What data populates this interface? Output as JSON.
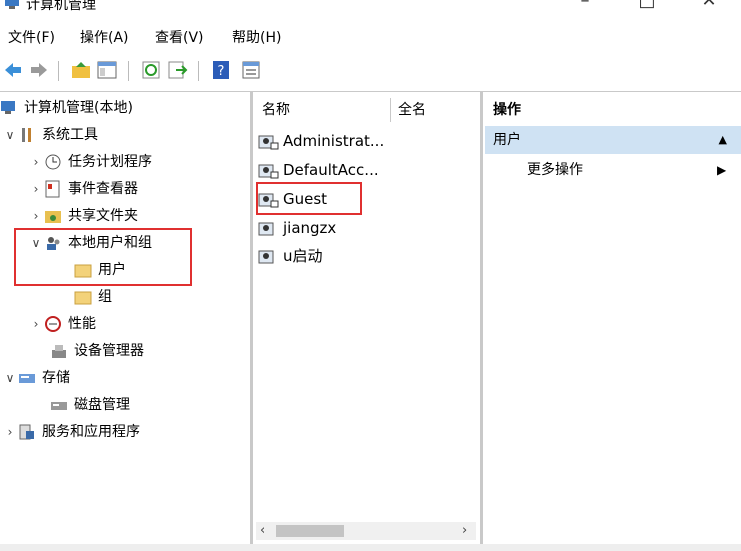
{
  "window": {
    "title": "计算机管理"
  },
  "menu": [
    "文件(F)",
    "操作(A)",
    "查看(V)",
    "帮助(H)"
  ],
  "tree": [
    {
      "label": "计算机管理(本地)"
    },
    {
      "label": "系统工具"
    },
    {
      "label": "任务计划程序"
    },
    {
      "label": "事件查看器"
    },
    {
      "label": "共享文件夹"
    },
    {
      "label": "本地用户和组"
    },
    {
      "label": "用户"
    },
    {
      "label": "组"
    },
    {
      "label": "性能"
    },
    {
      "label": "设备管理器"
    },
    {
      "label": "存储"
    },
    {
      "label": "磁盘管理"
    },
    {
      "label": "服务和应用程序"
    }
  ],
  "list": {
    "columns": [
      "名称",
      "全名"
    ],
    "rows": [
      "Administrat...",
      "DefaultAcc...",
      "Guest",
      "jiangzx",
      "u启动"
    ]
  },
  "actions": {
    "title": "操作",
    "section": "用户",
    "item": "更多操作"
  },
  "colors": {
    "highlight": "#e03030",
    "section_bg": "#cfe2f3"
  }
}
